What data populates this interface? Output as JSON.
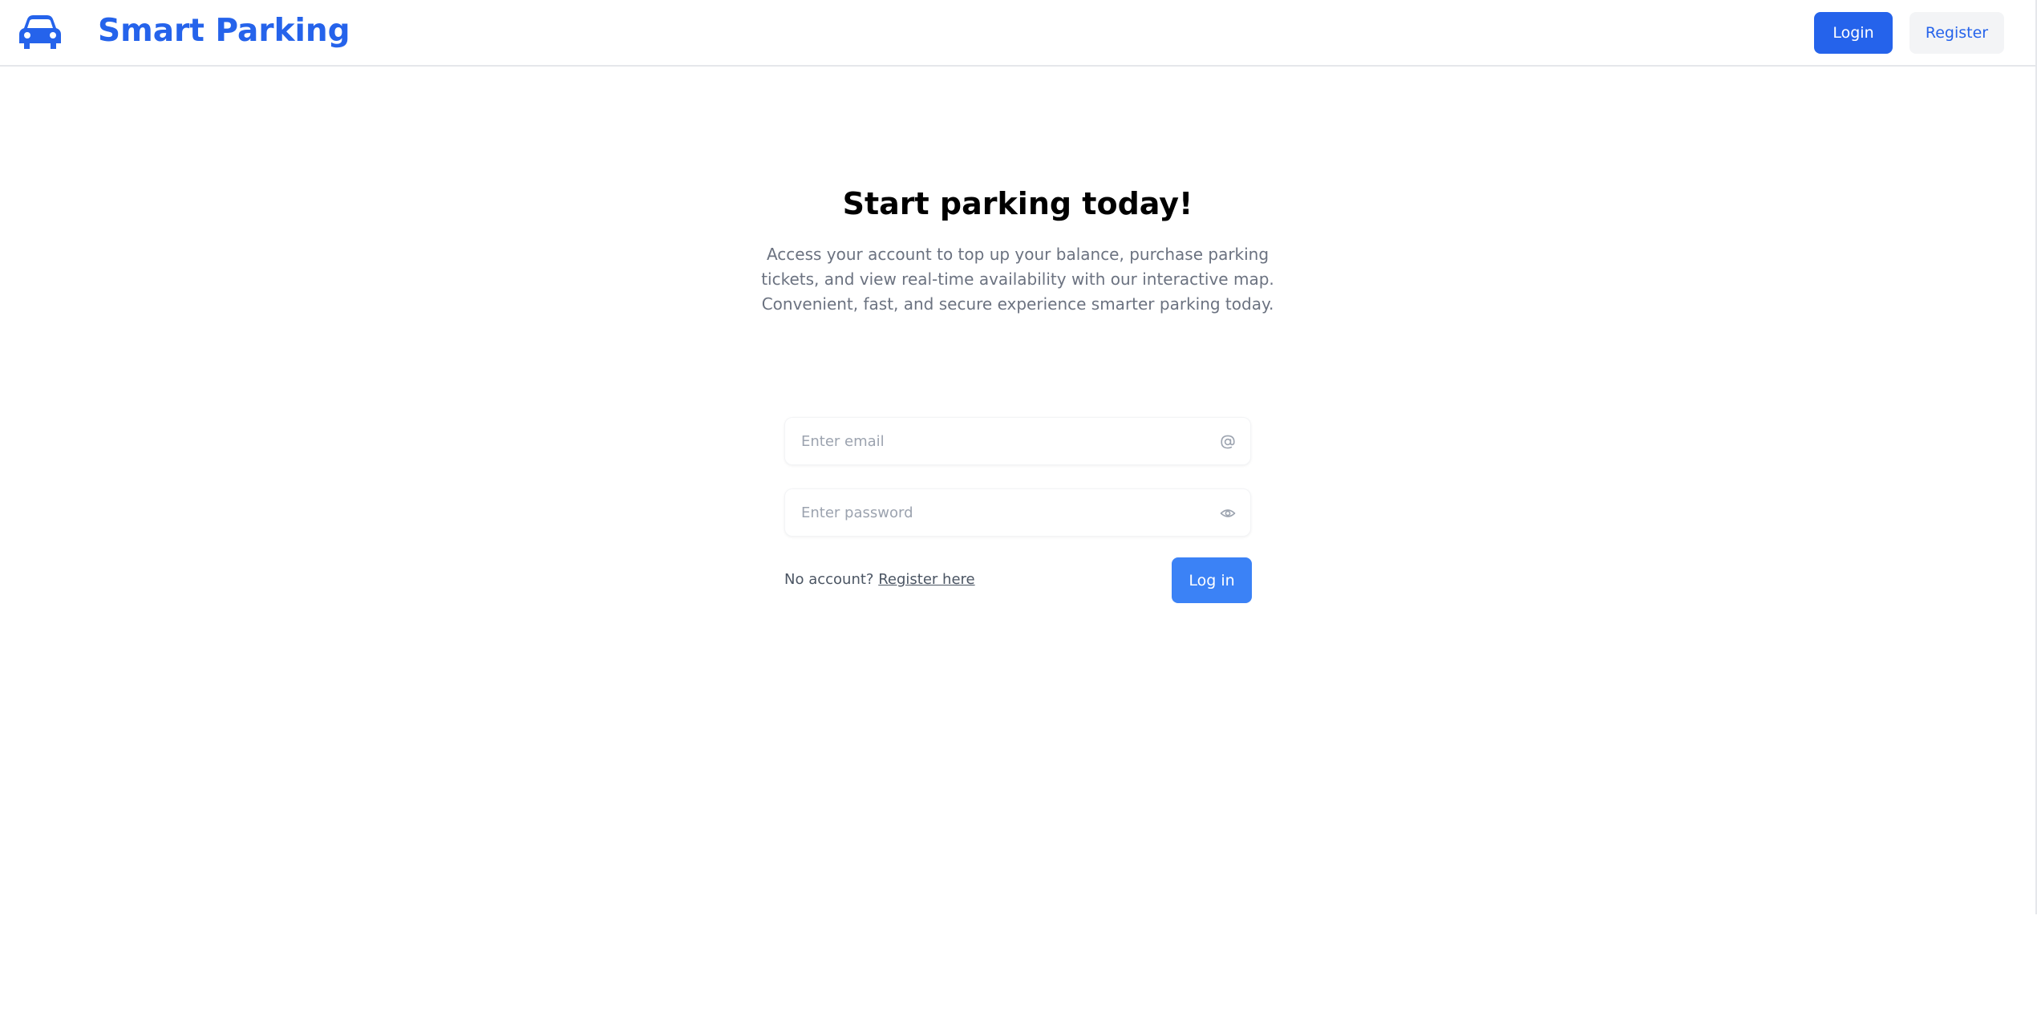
{
  "header": {
    "brand": "Smart Parking",
    "login_label": "Login",
    "register_label": "Register",
    "logo_icon": "car-icon"
  },
  "hero": {
    "title": "Start parking today!",
    "subtitle": "Access your account to top up your balance, purchase parking tickets, and view real-time availability with our interactive map. Convenient, fast, and secure experience smarter parking today."
  },
  "form": {
    "email_value": "",
    "email_placeholder": "Enter email",
    "email_icon": "at-sign-icon",
    "password_value": "",
    "password_placeholder": "Enter password",
    "password_icon": "eye-icon",
    "no_account_text": "No account?",
    "register_link": "Register here",
    "submit_label": "Log in"
  },
  "colors": {
    "brand": "#2563eb",
    "submit": "#3b82f6",
    "secondary_bg": "#f3f4f6",
    "muted_text": "#6b7280"
  }
}
